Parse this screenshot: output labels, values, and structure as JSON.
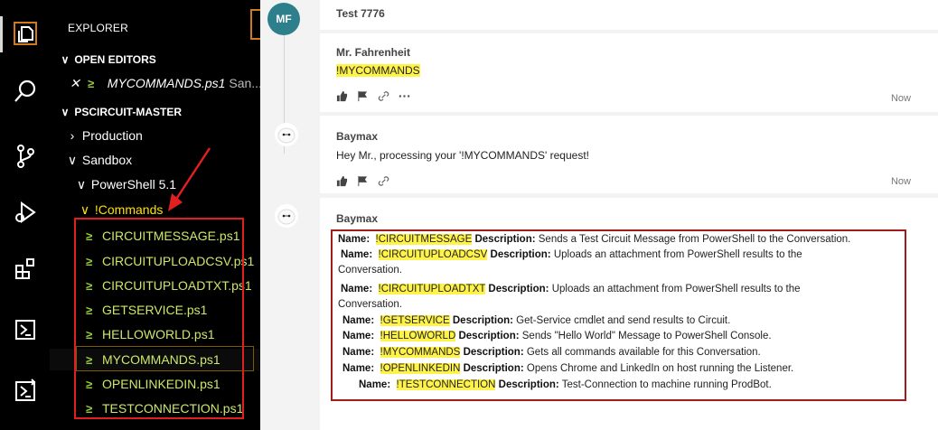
{
  "activity_icons": [
    "files-icon",
    "search-icon",
    "source-control-icon",
    "run-debug-icon",
    "extensions-icon",
    "powershell-icon",
    "powershell-command-icon"
  ],
  "explorer": {
    "title": "EXPLORER",
    "open_editors_label": "OPEN EDITORS",
    "open_file": "MYCOMMANDS.ps1",
    "open_file_suffix": "San...",
    "project_label": "PSCIRCUIT-MASTER",
    "tree": {
      "production": "Production",
      "sandbox": "Sandbox",
      "powershell": "PowerShell 5.1",
      "commands": "!Commands"
    },
    "files": [
      "CIRCUITMESSAGE.ps1",
      "CIRCUITUPLOADCSV.ps1",
      "CIRCUITUPLOADTXT.ps1",
      "GETSERVICE.ps1",
      "HELLOWORLD.ps1",
      "MYCOMMANDS.ps1",
      "OPENLINKEDIN.ps1",
      "TESTCONNECTION.ps1"
    ]
  },
  "conversation": {
    "title": "Test 7776",
    "avatar_initials": "MF",
    "messages": [
      {
        "sender": "Mr. Fahrenheit",
        "text": "!MYCOMMANDS",
        "time": "Now"
      },
      {
        "sender": "Baymax",
        "text": "Hey Mr., processing your '!MYCOMMANDS' request!",
        "time": "Now"
      },
      {
        "sender": "Baymax"
      }
    ],
    "name_label": "Name:",
    "desc_label": "Description:",
    "commands": [
      {
        "name": "!CIRCUITMESSAGE",
        "desc": "Sends a Test Circuit Message from PowerShell to the Conversation."
      },
      {
        "name": "!CIRCUITUPLOADCSV",
        "desc": "Uploads an attachment from PowerShell results to the",
        "cont": "Conversation."
      },
      {
        "name": "!CIRCUITUPLOADTXT",
        "desc": "Uploads an attachment from PowerShell results to the",
        "cont": "Conversation."
      },
      {
        "name": "!GETSERVICE",
        "desc": " Get-Service cmdlet and send results to Circuit."
      },
      {
        "name": "!HELLOWORLD",
        "desc": "Sends \"Hello World\" Message to PowerShell Console."
      },
      {
        "name": "!MYCOMMANDS",
        "desc": "Gets all commands available for this Conversation."
      },
      {
        "name": "!OPENLINKEDIN",
        "desc": "Opens Chrome and LinkedIn on host running the Listener."
      },
      {
        "name": "!TESTCONNECTION",
        "desc": "Test-Connection to machine running ProdBot."
      }
    ]
  },
  "colors": {
    "accent_orange": "#d07a1b",
    "annotation_red": "#e02020",
    "highlight_yellow": "#fff34a",
    "avatar_teal": "#2d7f8b"
  }
}
